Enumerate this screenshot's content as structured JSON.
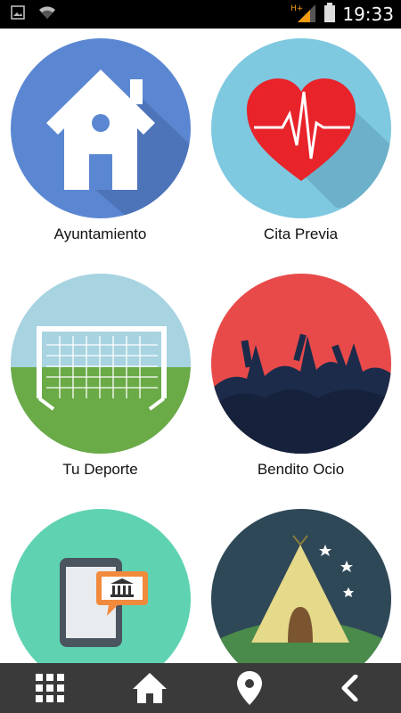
{
  "status_bar": {
    "time": "19:33",
    "network": "H+",
    "icons": [
      "image-notification-icon",
      "wifi-icon",
      "signal-icon",
      "battery-icon"
    ]
  },
  "tiles": [
    {
      "label": "Ayuntamiento",
      "icon": "house-icon",
      "color": "#5b87d2"
    },
    {
      "label": "Cita Previa",
      "icon": "heart-pulse-icon",
      "color": "#7ec8e0"
    },
    {
      "label": "Tu Deporte",
      "icon": "soccer-goal-icon",
      "color": "#6aaa47"
    },
    {
      "label": "Bendito Ocio",
      "icon": "crowd-concert-icon",
      "color": "#e84a4a"
    },
    {
      "label": "",
      "icon": "tablet-museum-icon",
      "color": "#5fd3b1"
    },
    {
      "label": "",
      "icon": "tent-camping-icon",
      "color": "#2f4858"
    }
  ],
  "navbar": {
    "items": [
      "apps-grid-icon",
      "home-icon",
      "location-pin-icon",
      "back-icon"
    ]
  }
}
